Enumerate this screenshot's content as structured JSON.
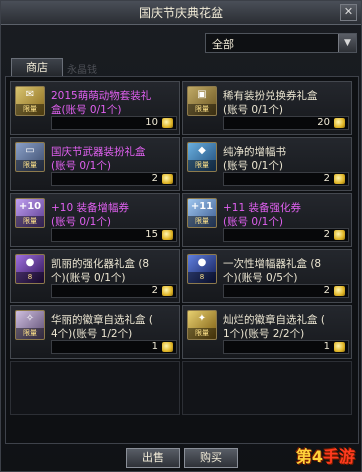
{
  "window": {
    "title": "国庆节庆典花盆",
    "close_label": "✕"
  },
  "filter": {
    "value": "全部",
    "arrow": "▼"
  },
  "tabs": [
    {
      "label": "商店"
    }
  ],
  "tab_ghost_text": "永晶钱",
  "items": [
    {
      "name_line1": "2015萌萌动物套装礼",
      "name_line2": "盒(账号 0/1个)",
      "price": "10",
      "name_color": "#e060f0",
      "thumb_glyph": "✉",
      "thumb_limit": "限量",
      "thumb_colors": [
        "#d8c470",
        "#8a6a1c"
      ]
    },
    {
      "name_line1": "稀有装扮兑换券礼盒",
      "name_line2": "(账号 0/1个)",
      "price": "20",
      "name_color": "#ece6d2",
      "thumb_glyph": "▣",
      "thumb_limit": "限量",
      "thumb_colors": [
        "#c0aa66",
        "#6a5420"
      ]
    },
    {
      "name_line1": "国庆节武器装扮礼盒",
      "name_line2": "(账号 0/1个)",
      "price": "2",
      "name_color": "#e060f0",
      "thumb_glyph": "▭",
      "thumb_limit": "限量",
      "thumb_colors": [
        "#8aa0c8",
        "#3a4a6a"
      ]
    },
    {
      "name_line1": "纯净的增幅书",
      "name_line2": "(账号 0/1个)",
      "price": "2",
      "name_color": "#ece6d2",
      "thumb_glyph": "◆",
      "thumb_limit": "限量",
      "thumb_colors": [
        "#6ab0e0",
        "#1e4a78"
      ]
    },
    {
      "name_line1": "+10 装备增幅券",
      "name_line2": "(账号 0/1个)",
      "price": "15",
      "name_color": "#e060f0",
      "thumb_glyph": "+10",
      "thumb_limit": "限量",
      "thumb_colors": [
        "#c0a0f0",
        "#5a3a90"
      ]
    },
    {
      "name_line1": "+11 装备强化券",
      "name_line2": "(账号 0/1个)",
      "price": "2",
      "name_color": "#e060f0",
      "thumb_glyph": "+11",
      "thumb_limit": "限量",
      "thumb_colors": [
        "#a0c8f0",
        "#3a5a90"
      ]
    },
    {
      "name_line1": "凯丽的强化器礼盒 (8",
      "name_line2": "个)(账号 0/1个)",
      "price": "2",
      "name_color": "#ece6d2",
      "thumb_glyph": "●",
      "thumb_limit": "8",
      "thumb_colors": [
        "#a070e0",
        "#2a1050"
      ]
    },
    {
      "name_line1": "一次性增幅器礼盒 (8",
      "name_line2": "个)(账号 0/5个)",
      "price": "2",
      "name_color": "#ece6d2",
      "thumb_glyph": "●",
      "thumb_limit": "8",
      "thumb_colors": [
        "#6080e0",
        "#101a50"
      ]
    },
    {
      "name_line1": "华丽的徽章自选礼盒 (",
      "name_line2": "4个)(账号 1/2个)",
      "price": "1",
      "name_color": "#ece6d2",
      "thumb_glyph": "✧",
      "thumb_limit": "限量",
      "thumb_colors": [
        "#d0c0e0",
        "#5a4a70"
      ]
    },
    {
      "name_line1": "灿烂的徽章自选礼盒 (",
      "name_line2": "1个)(账号 2/2个)",
      "price": "1",
      "name_color": "#ece6d2",
      "thumb_glyph": "✦",
      "thumb_limit": "限量",
      "thumb_colors": [
        "#e8d070",
        "#7a5a10"
      ]
    },
    {
      "empty": true
    },
    {
      "empty": true
    }
  ],
  "buttons": {
    "sell": "出售",
    "buy": "购买"
  },
  "watermark": {
    "part1": "第4",
    "part2": "手游"
  }
}
